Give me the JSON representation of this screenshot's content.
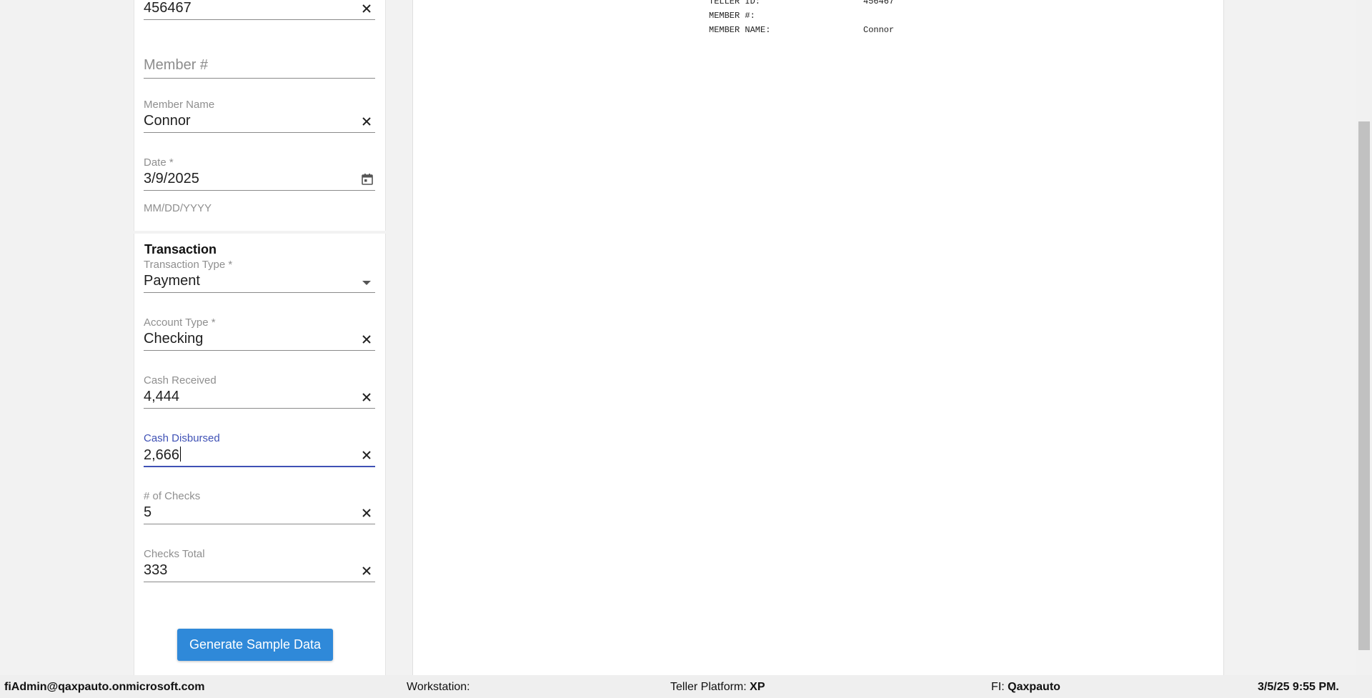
{
  "form": {
    "teller_id": {
      "value": "456467"
    },
    "member_number": {
      "placeholder": "Member #"
    },
    "member_name": {
      "label": "Member Name",
      "value": "Connor"
    },
    "date": {
      "label": "Date *",
      "value": "3/9/2025",
      "helper": "MM/DD/YYYY"
    },
    "transaction": {
      "title": "Transaction",
      "transaction_type": {
        "label": "Transaction Type *",
        "value": "Payment"
      },
      "account_type": {
        "label": "Account Type *",
        "value": "Checking"
      },
      "cash_received": {
        "label": "Cash Received",
        "value": "4,444"
      },
      "cash_disbursed": {
        "label": "Cash Disbursed",
        "value": "2,666"
      },
      "num_checks": {
        "label": "# of Checks",
        "value": "5"
      },
      "checks_total": {
        "label": "Checks Total",
        "value": "333"
      }
    },
    "generate_button": "Generate Sample Data"
  },
  "receipt": {
    "teller_id_label": "TELLER ID:",
    "teller_id_value": "456467",
    "member_number_label": "MEMBER #:",
    "member_number_value": "",
    "member_name_label": "MEMBER NAME:",
    "member_name_value": "Connor"
  },
  "status_bar": {
    "user": "fiAdmin@qaxpauto.onmicrosoft.com",
    "workstation_label": "Workstation:",
    "workstation_value": "",
    "platform_label": "Teller Platform:",
    "platform_value": "XP",
    "fi_label": "FI:",
    "fi_value": "Qaxpauto",
    "datetime": "3/5/25 9:55 PM."
  },
  "colors": {
    "accent": "#3f51b5",
    "button": "#2f89d9",
    "panel_bg": "#ffffff",
    "page_bg": "#f2f2f2"
  },
  "icons": {
    "clear": "close-icon",
    "date": "calendar-icon",
    "dropdown": "caret-down-icon"
  }
}
